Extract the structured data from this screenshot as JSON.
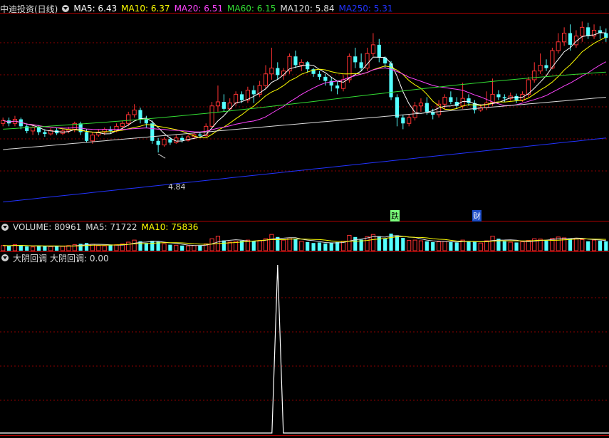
{
  "main_header": {
    "title": "中迪投资(日线)",
    "ma": [
      {
        "label": "MA5: 6.43",
        "color": "#ffffff"
      },
      {
        "label": "MA10: 6.37",
        "color": "#ffff00"
      },
      {
        "label": "MA20: 6.51",
        "color": "#ff44ff"
      },
      {
        "label": "MA60: 6.15",
        "color": "#33dd33"
      },
      {
        "label": "MA120: 5.84",
        "color": "#dddddd"
      },
      {
        "label": "MA250: 5.31",
        "color": "#2233ff"
      }
    ]
  },
  "vol_header": [
    {
      "label": "VOLUME: 80961",
      "color": "#dddddd"
    },
    {
      "label": "MA5: 71722",
      "color": "#dddddd"
    },
    {
      "label": "MA10: 75836",
      "color": "#ffff00"
    }
  ],
  "ind_header": {
    "label1": "大阴回调",
    "label2": "大阴回调: 0.00"
  },
  "annotations": {
    "low": "4.84",
    "fall": "跌",
    "fin": "财"
  },
  "colors": {
    "up": "#ff3232",
    "down": "#54ffff",
    "grid": "#8b0000",
    "border": "#b00000",
    "ind": "#ffffff"
  },
  "chart_data": {
    "type": "candlestick",
    "candles": [
      [
        6.05,
        6.1,
        6.0,
        6.15
      ],
      [
        6.1,
        6.05,
        6.0,
        6.15
      ],
      [
        6.05,
        6.12,
        6.0,
        6.18
      ],
      [
        6.12,
        6.0,
        5.95,
        6.15
      ],
      [
        6.0,
        5.92,
        5.88,
        6.05
      ],
      [
        5.92,
        5.98,
        5.85,
        6.02
      ],
      [
        5.98,
        5.9,
        5.85,
        6.02
      ],
      [
        5.9,
        5.87,
        5.82,
        5.95
      ],
      [
        5.87,
        5.93,
        5.84,
        5.97
      ],
      [
        5.93,
        5.88,
        5.85,
        5.97
      ],
      [
        5.88,
        5.92,
        5.85,
        5.96
      ],
      [
        5.92,
        5.95,
        5.88,
        5.99
      ],
      [
        5.95,
        6.05,
        5.9,
        6.08
      ],
      [
        6.05,
        5.9,
        5.85,
        6.08
      ],
      [
        5.9,
        5.75,
        5.72,
        5.95
      ],
      [
        5.75,
        5.85,
        5.7,
        5.9
      ],
      [
        5.85,
        5.9,
        5.82,
        5.95
      ],
      [
        5.9,
        5.95,
        5.85,
        5.98
      ],
      [
        5.95,
        5.92,
        5.88,
        6.0
      ],
      [
        5.92,
        6.0,
        5.9,
        6.05
      ],
      [
        6.0,
        6.05,
        5.95,
        6.1
      ],
      [
        6.05,
        6.2,
        6.0,
        6.25
      ],
      [
        6.2,
        6.28,
        6.15,
        6.38
      ],
      [
        6.28,
        6.12,
        6.05,
        6.32
      ],
      [
        6.12,
        6.05,
        5.98,
        6.18
      ],
      [
        6.05,
        5.75,
        5.7,
        6.1
      ],
      [
        5.75,
        5.68,
        5.55,
        5.8
      ],
      [
        5.68,
        5.78,
        5.65,
        5.82
      ],
      [
        5.78,
        5.72,
        5.68,
        5.82
      ],
      [
        5.72,
        5.8,
        5.7,
        5.85
      ],
      [
        5.8,
        5.76,
        5.72,
        5.84
      ],
      [
        5.76,
        5.82,
        5.74,
        5.86
      ],
      [
        5.82,
        5.86,
        5.78,
        5.9
      ],
      [
        5.86,
        5.84,
        5.8,
        5.9
      ],
      [
        5.84,
        6.0,
        5.82,
        6.05
      ],
      [
        6.0,
        6.35,
        5.98,
        6.42
      ],
      [
        6.35,
        6.42,
        6.25,
        6.7
      ],
      [
        6.42,
        6.3,
        6.25,
        6.55
      ],
      [
        6.3,
        6.4,
        6.28,
        6.48
      ],
      [
        6.4,
        6.55,
        6.35,
        6.6
      ],
      [
        6.55,
        6.45,
        6.4,
        6.6
      ],
      [
        6.45,
        6.62,
        6.4,
        6.68
      ],
      [
        6.62,
        6.55,
        6.4,
        6.7
      ],
      [
        6.55,
        6.7,
        6.5,
        6.78
      ],
      [
        6.7,
        6.9,
        6.65,
        7.05
      ],
      [
        6.9,
        7.0,
        6.8,
        7.35
      ],
      [
        7.0,
        6.88,
        6.8,
        7.1
      ],
      [
        6.88,
        6.95,
        6.8,
        7.0
      ],
      [
        6.95,
        7.2,
        6.9,
        7.25
      ],
      [
        7.2,
        7.05,
        7.0,
        7.3
      ],
      [
        7.05,
        7.1,
        6.95,
        7.15
      ],
      [
        7.1,
        6.98,
        6.92,
        7.12
      ],
      [
        6.98,
        6.9,
        6.85,
        7.0
      ],
      [
        6.9,
        6.85,
        6.8,
        6.95
      ],
      [
        6.85,
        6.78,
        6.7,
        6.9
      ],
      [
        6.78,
        6.7,
        6.6,
        6.85
      ],
      [
        6.7,
        6.65,
        6.55,
        6.78
      ],
      [
        6.65,
        6.8,
        6.6,
        6.88
      ],
      [
        6.8,
        7.2,
        6.75,
        7.25
      ],
      [
        7.2,
        7.1,
        7.0,
        7.35
      ],
      [
        7.1,
        7.0,
        6.95,
        7.25
      ],
      [
        7.0,
        7.25,
        6.95,
        7.35
      ],
      [
        7.25,
        7.4,
        7.2,
        7.6
      ],
      [
        7.4,
        7.18,
        7.1,
        7.5
      ],
      [
        7.18,
        7.08,
        7.0,
        7.2
      ],
      [
        7.08,
        6.5,
        6.45,
        7.12
      ],
      [
        6.5,
        6.15,
        6.0,
        6.55
      ],
      [
        6.15,
        6.05,
        5.95,
        6.2
      ],
      [
        6.05,
        6.15,
        6.0,
        6.2
      ],
      [
        6.15,
        6.35,
        6.1,
        6.42
      ],
      [
        6.35,
        6.4,
        6.25,
        6.48
      ],
      [
        6.4,
        6.25,
        6.2,
        6.5
      ],
      [
        6.25,
        6.2,
        6.12,
        6.3
      ],
      [
        6.2,
        6.38,
        6.15,
        6.45
      ],
      [
        6.38,
        6.5,
        6.3,
        6.55
      ],
      [
        6.5,
        6.42,
        6.38,
        6.6
      ],
      [
        6.42,
        6.35,
        6.3,
        6.5
      ],
      [
        6.35,
        6.48,
        6.3,
        6.75
      ],
      [
        6.48,
        6.4,
        6.35,
        6.55
      ],
      [
        6.4,
        6.28,
        6.22,
        6.45
      ],
      [
        6.28,
        6.32,
        6.25,
        6.38
      ],
      [
        6.32,
        6.4,
        6.28,
        6.6
      ],
      [
        6.4,
        6.55,
        6.35,
        6.82
      ],
      [
        6.55,
        6.5,
        6.45,
        6.62
      ],
      [
        6.5,
        6.48,
        6.42,
        6.55
      ],
      [
        6.48,
        6.52,
        6.44,
        6.58
      ],
      [
        6.52,
        6.45,
        6.4,
        6.56
      ],
      [
        6.45,
        6.55,
        6.42,
        6.6
      ],
      [
        6.55,
        6.8,
        6.5,
        6.85
      ],
      [
        6.8,
        6.95,
        6.75,
        7.1
      ],
      [
        6.95,
        7.05,
        6.9,
        7.25
      ],
      [
        7.05,
        7.0,
        6.95,
        7.15
      ],
      [
        7.0,
        7.3,
        6.98,
        7.35
      ],
      [
        7.3,
        7.45,
        7.25,
        7.6
      ],
      [
        7.45,
        7.6,
        7.38,
        7.7
      ],
      [
        7.6,
        7.4,
        7.3,
        7.75
      ],
      [
        7.4,
        7.55,
        7.35,
        7.65
      ],
      [
        7.55,
        7.7,
        7.45,
        7.8
      ],
      [
        7.7,
        7.55,
        7.5,
        7.78
      ],
      [
        7.55,
        7.65,
        7.5,
        7.75
      ],
      [
        7.65,
        7.6,
        7.5,
        7.72
      ],
      [
        7.6,
        7.52,
        7.45,
        7.68
      ]
    ],
    "ylim": [
      4.5,
      7.9
    ],
    "volumes": [
      0.3,
      0.28,
      0.35,
      0.3,
      0.25,
      0.22,
      0.3,
      0.26,
      0.24,
      0.28,
      0.25,
      0.3,
      0.35,
      0.4,
      0.45,
      0.38,
      0.3,
      0.28,
      0.32,
      0.35,
      0.4,
      0.5,
      0.62,
      0.55,
      0.45,
      0.58,
      0.52,
      0.4,
      0.35,
      0.32,
      0.3,
      0.28,
      0.3,
      0.32,
      0.4,
      0.7,
      0.85,
      0.6,
      0.5,
      0.55,
      0.58,
      0.62,
      0.55,
      0.6,
      0.7,
      0.95,
      0.8,
      0.62,
      0.75,
      0.68,
      0.55,
      0.5,
      0.45,
      0.48,
      0.42,
      0.45,
      0.5,
      0.55,
      0.9,
      0.8,
      0.65,
      0.82,
      0.95,
      0.85,
      0.7,
      1.0,
      0.9,
      0.75,
      0.6,
      0.62,
      0.58,
      0.55,
      0.5,
      0.52,
      0.55,
      0.5,
      0.48,
      0.62,
      0.55,
      0.52,
      0.45,
      0.58,
      0.85,
      0.7,
      0.55,
      0.5,
      0.48,
      0.52,
      0.6,
      0.7,
      0.68,
      0.6,
      0.72,
      0.8,
      0.75,
      0.7,
      0.72,
      0.65,
      0.55,
      0.62,
      0.58,
      0.55
    ],
    "indicator": {
      "peak_index": 46,
      "peak_value": 1.0,
      "baseline": 0
    }
  }
}
